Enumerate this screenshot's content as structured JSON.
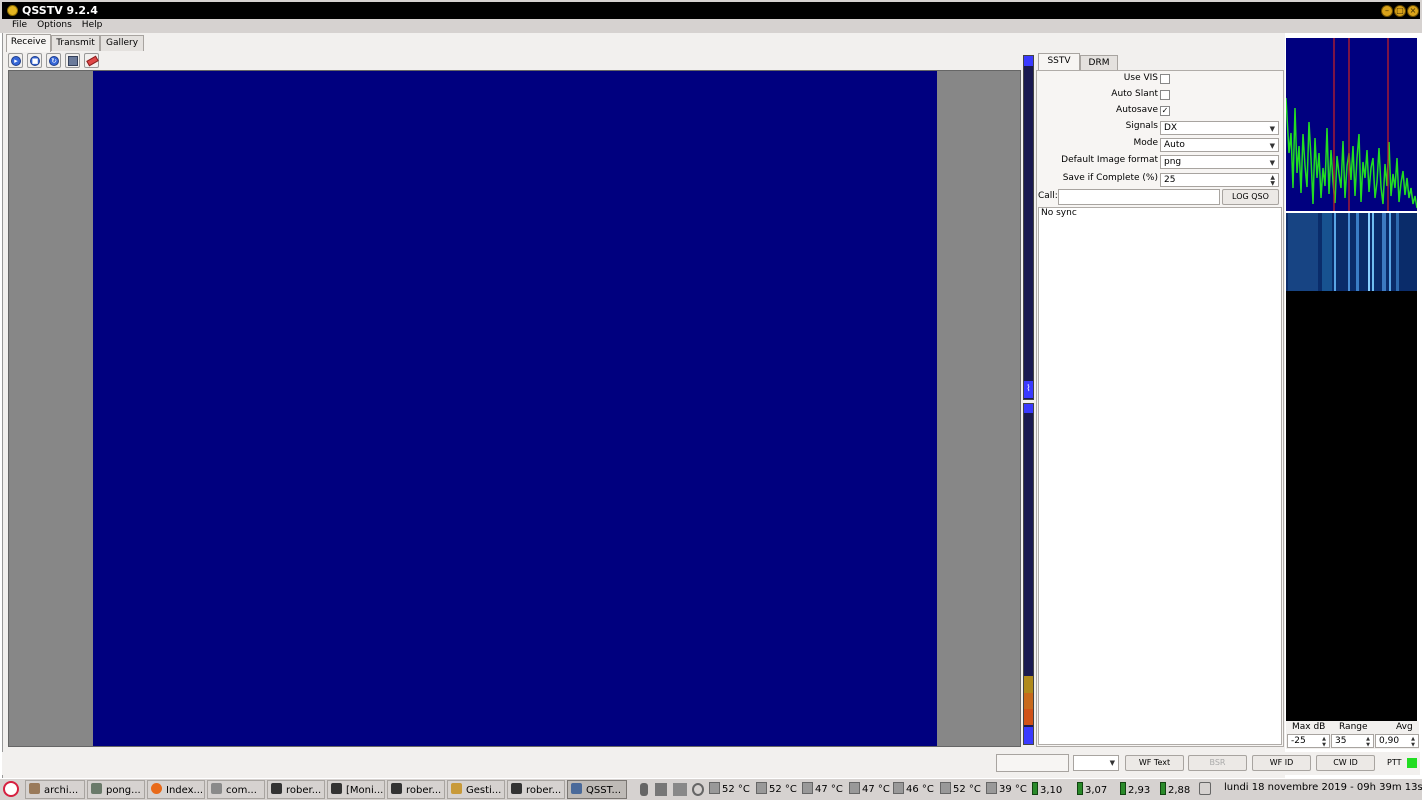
{
  "window": {
    "title": "QSSTV 9.2.4"
  },
  "menu": [
    "File",
    "Options",
    "Help"
  ],
  "tabs": [
    "Receive",
    "Transmit",
    "Gallery"
  ],
  "settings": {
    "tabs": [
      "SSTV",
      "DRM"
    ],
    "use_vis_label": "Use VIS",
    "use_vis": false,
    "auto_slant_label": "Auto Slant",
    "auto_slant": false,
    "autosave_label": "Autosave",
    "autosave": true,
    "signals_label": "Signals",
    "signals_value": "DX",
    "mode_label": "Mode",
    "mode_value": "Auto",
    "image_format_label": "Default Image format",
    "image_format_value": "png",
    "save_complete_label": "Save if Complete (%)",
    "save_complete_value": "25",
    "call_label": "Call:",
    "call_value": "",
    "log_qso_label": "LOG QSO",
    "sync_status": "No sync"
  },
  "spectrum_controls": {
    "max_db_label": "Max dB",
    "max_db_value": "-25",
    "range_label": "Range",
    "range_value": "35",
    "avg_label": "Avg",
    "avg_value": "0,90"
  },
  "statusbar": {
    "wf_text_label": "WF Text",
    "bsr_label": "BSR",
    "wf_id_label": "WF ID",
    "cw_id_label": "CW ID",
    "ptt_label": "PTT",
    "ptt_color": "#22dd22"
  },
  "taskbar": {
    "tasks": [
      "archi...",
      "pong...",
      "Index...",
      "com...",
      "rober...",
      "[Moni...",
      "rober...",
      "Gesti...",
      "rober...",
      "QSST..."
    ],
    "sensors": [
      "52 °C",
      "52 °C",
      "47 °C",
      "47 °C",
      "46 °C",
      "52 °C",
      "39 °C"
    ],
    "cpu": [
      "3,10",
      "3,07",
      "2,93",
      "2,88"
    ],
    "clock": "lundi 18 novembre 2019 - 09h 39m 13s"
  },
  "colors": {
    "image_background": "#00007f",
    "spectrum_trace": "#22dd22",
    "marker_lines": "#cc2222"
  }
}
